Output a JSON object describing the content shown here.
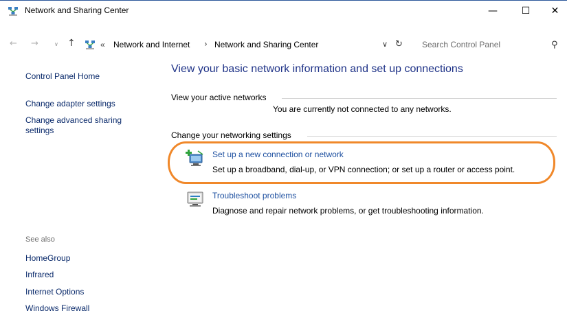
{
  "window": {
    "title": "Network and Sharing Center",
    "controls": {
      "minimize": "—",
      "maximize": "☐",
      "close": "✕"
    }
  },
  "nav": {
    "back": "←",
    "forward": "→",
    "recent": "∨",
    "up": "↑",
    "overflow": "«",
    "breadcrumb": [
      "Network and Internet",
      "Network and Sharing Center"
    ],
    "separator": "›",
    "dropdown": "∨",
    "refresh": "↻"
  },
  "search": {
    "placeholder": "Search Control Panel",
    "icon": "⚲"
  },
  "sidebar": {
    "home": "Control Panel Home",
    "links": [
      "Change adapter settings",
      "Change advanced sharing settings"
    ],
    "see_also_label": "See also",
    "see_also": [
      "HomeGroup",
      "Infrared",
      "Internet Options",
      "Windows Firewall"
    ]
  },
  "main": {
    "title": "View your basic network information and set up connections",
    "active_networks_label": "View your active networks",
    "not_connected": "You are currently not connected to any networks.",
    "change_settings_label": "Change your networking settings",
    "tasks": [
      {
        "link": "Set up a new connection or network",
        "desc": "Set up a broadband, dial-up, or VPN connection; or set up a router or access point."
      },
      {
        "link": "Troubleshoot problems",
        "desc": "Diagnose and repair network problems, or get troubleshooting information."
      }
    ]
  },
  "colors": {
    "link": "#1e50a0",
    "title": "#1e3287",
    "highlight": "#f0882a"
  }
}
